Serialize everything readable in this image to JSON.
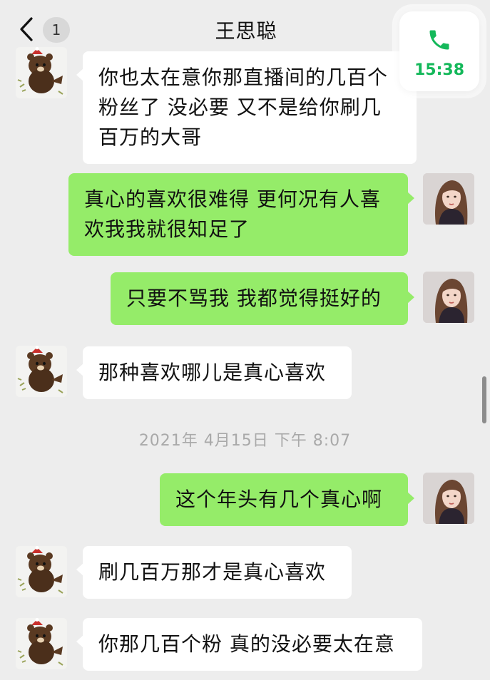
{
  "header": {
    "title": "王思聪",
    "unread_count": "1",
    "back_icon": "chevron-left-icon"
  },
  "call_widget": {
    "icon": "phone-icon",
    "time": "15:38",
    "accent": "#14b85a"
  },
  "colors": {
    "background": "#ededed",
    "incoming_bubble": "#ffffff",
    "outgoing_bubble": "#95ec69"
  },
  "messages": [
    {
      "side": "in",
      "text": "你也太在意你那直播间的几百个粉丝了 没必要 又不是给你刷几百万的大哥"
    },
    {
      "side": "out",
      "text": "真心的喜欢很难得 更何况有人喜欢我我就很知足了"
    },
    {
      "side": "out",
      "text": "只要不骂我 我都觉得挺好的"
    },
    {
      "side": "in",
      "text": "那种喜欢哪儿是真心喜欢"
    },
    {
      "side": "out",
      "text": "这个年头有几个真心啊"
    },
    {
      "side": "in",
      "text": "刷几百万那才是真心喜欢"
    },
    {
      "side": "in",
      "text": "你那几百个粉 真的没必要太在意"
    }
  ],
  "timestamp": "2021年 4月15日 下午 8:07"
}
